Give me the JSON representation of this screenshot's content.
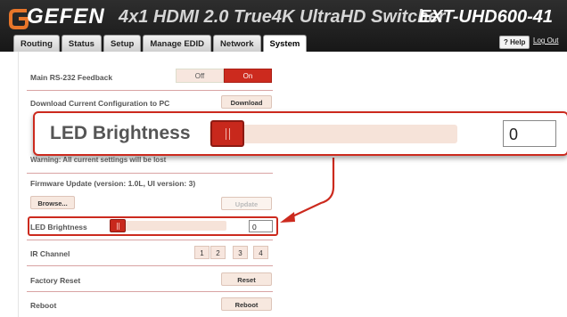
{
  "header": {
    "logo_text": "GEFEN",
    "product_title": "4x1 HDMI 2.0 True4K UltraHD Switcher",
    "model": "EXT-UHD600-41",
    "help_label": "? Help",
    "logout_label": "Log Out"
  },
  "tabs": [
    {
      "label": "Routing"
    },
    {
      "label": "Status"
    },
    {
      "label": "Setup"
    },
    {
      "label": "Manage EDID"
    },
    {
      "label": "Network"
    },
    {
      "label": "System"
    }
  ],
  "active_tab": "System",
  "system": {
    "rs232": {
      "label": "Main RS-232 Feedback",
      "off_label": "Off",
      "on_label": "On",
      "state": "On"
    },
    "download": {
      "label": "Download Current Configuration to PC",
      "button": "Download"
    },
    "warning": "Warning: All current settings will be lost",
    "firmware": {
      "label": "Firmware Update (version: 1.0L, UI version: 3)",
      "browse_label": "Browse...",
      "update_label": "Update"
    },
    "led": {
      "label": "LED Brightness",
      "value": "0"
    },
    "ir": {
      "label": "IR Channel",
      "channels": [
        "1",
        "2",
        "3",
        "4"
      ]
    },
    "factory_reset": {
      "label": "Factory Reset",
      "button": "Reset"
    },
    "reboot": {
      "label": "Reboot",
      "button": "Reboot"
    }
  },
  "zoom_callout": {
    "label": "LED Brightness",
    "value": "0"
  },
  "colors": {
    "accent": "#cc2a1e",
    "header_bg": "#1e1e1e",
    "track": "#f6e3d9"
  }
}
